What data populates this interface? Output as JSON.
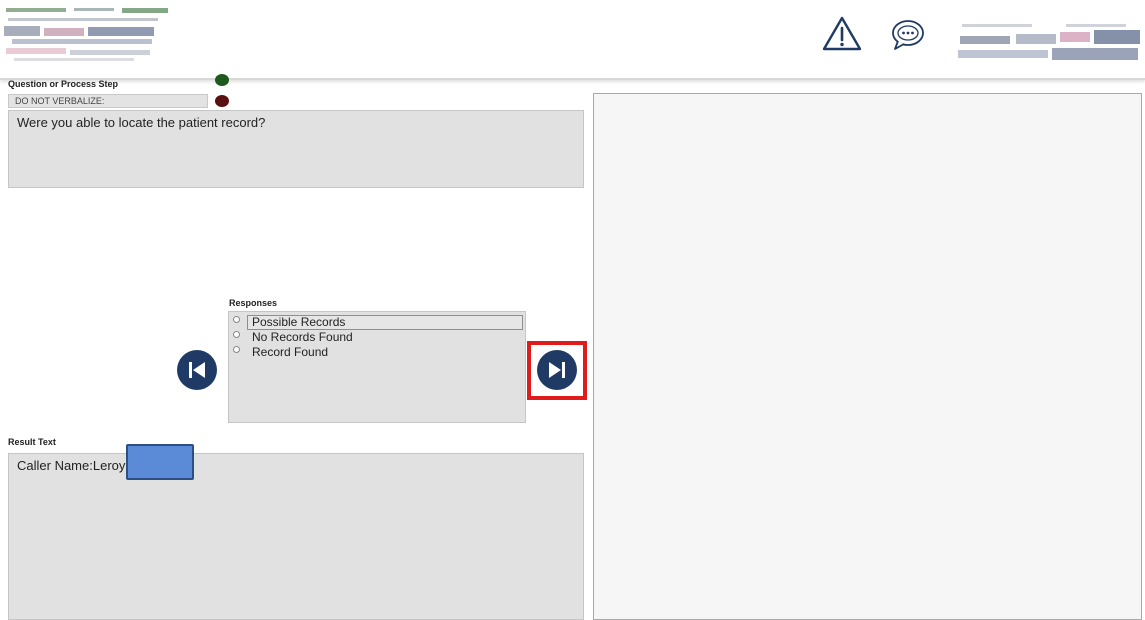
{
  "header": {
    "warning_icon": "warning-triangle-icon",
    "chat_icon": "chat-bubble-icon"
  },
  "question": {
    "section_label": "Question or Process Step",
    "status_colors": {
      "upper": "#1e5a1e",
      "lower": "#5a1010"
    },
    "do_not_verbalize": "DO NOT VERBALIZE:",
    "text": "Were you able to locate the patient record?"
  },
  "responses": {
    "label": "Responses",
    "options": [
      "Possible Records",
      "No Records Found",
      "Record Found"
    ],
    "selected_index": 0
  },
  "navigation": {
    "prev_icon": "skip-back-icon",
    "next_icon": "skip-forward-icon",
    "button_color": "#1f3a64",
    "highlight_color": "#e01b1b"
  },
  "result": {
    "label": "Result Text",
    "text": "Caller Name:Leroy"
  }
}
